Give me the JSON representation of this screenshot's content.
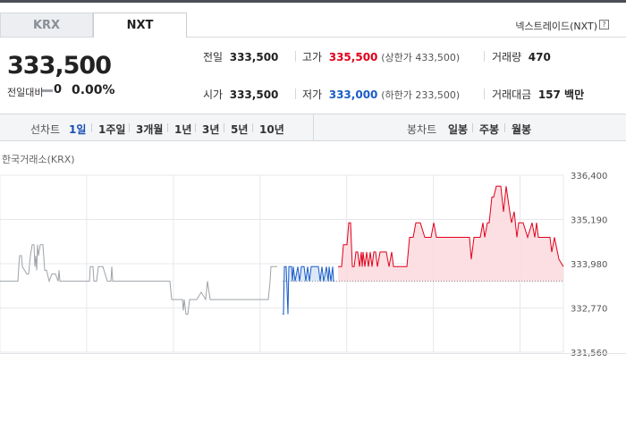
{
  "tabs": {
    "krx": "KRX",
    "nxt": "NXT"
  },
  "market_name": "넥스트레이드(NXT)",
  "help_icon_glyph": "?",
  "price": {
    "current": "333,500",
    "change_label": "전일대비",
    "change_value": "0",
    "change_rate": "0.00%"
  },
  "quote": {
    "prev_label": "전일",
    "prev_value": "333,500",
    "high_label": "고가",
    "high_value": "335,500",
    "upper_limit": "(상한가 433,500)",
    "volume_label": "거래량",
    "volume_value": "470",
    "open_label": "시가",
    "open_value": "333,500",
    "low_label": "저가",
    "low_value": "333,000",
    "lower_limit": "(하한가 233,500)",
    "amount_label": "거래대금",
    "amount_value": "157 백만"
  },
  "chart_tabs": {
    "line_label": "선차트",
    "line_items": [
      "1일",
      "1주일",
      "3개월",
      "1년",
      "3년",
      "5년",
      "10년"
    ],
    "active_index": 0,
    "candle_label": "봉차트",
    "candle_items": [
      "일봉",
      "주봉",
      "월봉"
    ]
  },
  "colors": {
    "up": "#e0001b",
    "down": "#1a5dc8",
    "prev": "#9ea3a8"
  },
  "chart_data": {
    "type": "line",
    "subtitle": "한국거래소(KRX)",
    "x_range": [
      0,
      630
    ],
    "yticks": [
      "336,400",
      "335,190",
      "333,980",
      "332,770",
      "331,560"
    ],
    "ylim": [
      331560,
      336400
    ],
    "baseline": 333500,
    "grid": true,
    "series": [
      {
        "segment": "krx",
        "x": [
          0,
          5,
          10,
          15,
          20,
          21,
          22,
          24,
          25,
          30,
          32,
          34,
          36,
          38,
          39,
          40,
          41,
          42,
          43,
          45,
          48,
          50,
          52,
          55,
          58,
          62,
          65,
          66,
          67,
          70,
          75,
          80,
          85,
          95,
          100,
          101,
          104,
          105,
          108,
          110,
          115,
          120,
          124,
          125,
          126,
          130,
          135,
          138,
          140,
          145,
          150,
          155,
          160,
          170,
          175,
          182,
          190,
          192,
          195,
          200,
          204,
          205,
          206,
          208,
          210,
          212,
          215,
          220,
          225,
          230,
          232,
          235,
          240,
          250,
          260,
          265,
          270,
          280,
          290,
          300,
          302,
          303,
          310
        ],
        "y": [
          333500,
          333500,
          333500,
          333500,
          333500,
          333900,
          334200,
          334200,
          333900,
          333700,
          333700,
          334200,
          334500,
          334500,
          333900,
          334200,
          333800,
          334500,
          334200,
          334500,
          334500,
          333800,
          333800,
          333500,
          333700,
          333700,
          333500,
          333800,
          333500,
          333500,
          333500,
          333500,
          333500,
          333500,
          333500,
          333900,
          333900,
          333500,
          333500,
          333900,
          333900,
          333500,
          333500,
          333900,
          333500,
          333500,
          333500,
          333500,
          333500,
          333500,
          333500,
          333500,
          333500,
          333500,
          333500,
          333500,
          333500,
          333000,
          333000,
          333000,
          333000,
          332700,
          333000,
          332600,
          332600,
          333000,
          333000,
          333000,
          333200,
          333000,
          333500,
          333000,
          333000,
          333000,
          333000,
          333000,
          333000,
          333000,
          333000,
          333000,
          333500,
          333900,
          333900
        ]
      },
      {
        "segment": "nxt-down",
        "x": [
          316,
          317,
          318,
          320,
          322,
          323,
          324,
          326,
          327,
          328,
          330,
          333,
          335,
          337,
          340,
          342,
          344,
          346,
          348,
          350,
          352,
          354,
          356,
          358,
          360,
          362,
          365,
          367,
          368,
          370,
          372,
          373,
          374
        ],
        "y": [
          332600,
          332600,
          333900,
          333900,
          332600,
          333900,
          333900,
          333900,
          333500,
          333900,
          333500,
          333900,
          333500,
          333900,
          333900,
          333500,
          333900,
          333500,
          333900,
          333900,
          333900,
          333900,
          333900,
          333500,
          333900,
          333500,
          333900,
          333500,
          333900,
          333500,
          333900,
          333500,
          333500
        ]
      },
      {
        "segment": "nxt-up",
        "x": [
          378,
          380,
          382,
          384,
          386,
          388,
          390,
          392,
          394,
          396,
          398,
          400,
          402,
          404,
          405,
          406,
          408,
          410,
          412,
          414,
          416,
          418,
          420,
          422,
          425,
          428,
          430,
          432,
          435,
          438,
          440,
          445,
          450,
          455,
          458,
          460,
          462,
          465,
          470,
          475,
          480,
          482,
          485,
          488,
          490,
          495,
          500,
          505,
          510,
          515,
          520,
          525,
          527,
          530,
          535,
          537,
          540,
          542,
          545,
          547,
          550,
          552,
          555,
          557,
          560,
          563,
          566,
          570,
          572,
          575,
          578,
          580,
          585,
          590,
          595,
          598,
          600,
          602,
          605,
          610,
          615,
          617,
          620,
          625,
          630
        ],
        "y": [
          333900,
          333900,
          333900,
          334500,
          334500,
          334500,
          335100,
          335100,
          333900,
          333900,
          334300,
          334300,
          333900,
          334300,
          333900,
          334300,
          333900,
          334300,
          333900,
          334300,
          333900,
          334300,
          334300,
          333900,
          334300,
          334300,
          334300,
          334300,
          333900,
          334300,
          333900,
          333900,
          333900,
          333900,
          334700,
          334700,
          334700,
          335100,
          335100,
          334700,
          334700,
          334700,
          335100,
          334700,
          334700,
          334700,
          334700,
          334700,
          334700,
          334700,
          334700,
          334700,
          334100,
          334700,
          334700,
          334700,
          335100,
          334700,
          335100,
          335100,
          335800,
          335800,
          336100,
          336100,
          336100,
          335400,
          336100,
          335400,
          335100,
          335400,
          334700,
          335100,
          335100,
          334700,
          335100,
          334700,
          335100,
          334700,
          334700,
          334700,
          334700,
          334300,
          334700,
          334100,
          333900
        ]
      }
    ]
  }
}
